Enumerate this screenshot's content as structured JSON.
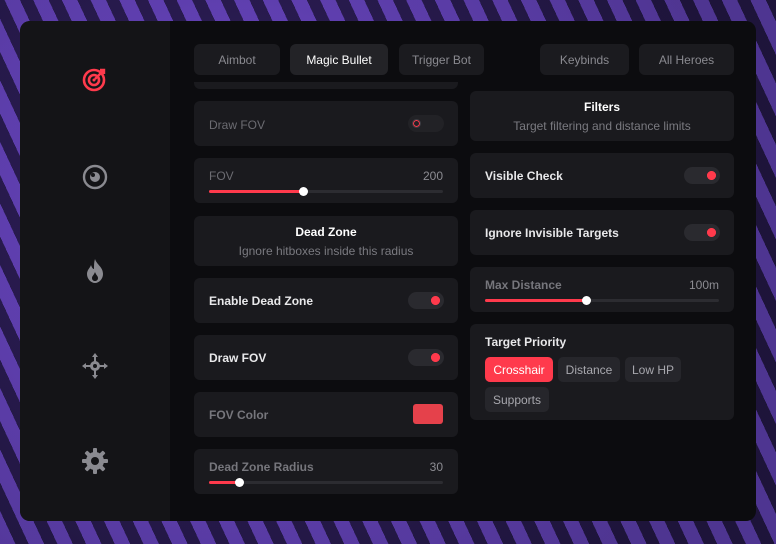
{
  "sidebar": {
    "items": [
      {
        "icon": "target-icon",
        "active": true
      },
      {
        "icon": "eye-icon",
        "active": false
      },
      {
        "icon": "flame-icon",
        "active": false
      },
      {
        "icon": "crosshair-move-icon",
        "active": false
      },
      {
        "icon": "gear-icon",
        "active": false
      }
    ]
  },
  "tabs": {
    "aimbot": "Aimbot",
    "magic_bullet": "Magic Bullet",
    "trigger_bot": "Trigger Bot",
    "keybinds": "Keybinds",
    "all_heroes": "All Heroes"
  },
  "left": {
    "draw_fov_disabled": {
      "label": "Draw FOV",
      "enabled": false
    },
    "fov": {
      "label": "FOV",
      "value": "200",
      "fraction": 0.4
    },
    "dead_zone_header": {
      "title": "Dead Zone",
      "subtitle": "Ignore hitboxes inside this radius"
    },
    "enable_dead_zone": {
      "label": "Enable Dead Zone",
      "enabled": true
    },
    "draw_fov": {
      "label": "Draw FOV",
      "enabled": true
    },
    "fov_color": {
      "label": "FOV Color",
      "color": "#e5414b"
    },
    "dead_zone_radius": {
      "label": "Dead Zone Radius",
      "value": "30",
      "fraction": 0.13
    }
  },
  "right": {
    "filters_header": {
      "title": "Filters",
      "subtitle": "Target filtering and distance limits"
    },
    "visible_check": {
      "label": "Visible Check",
      "enabled": true
    },
    "ignore_invisible": {
      "label": "Ignore Invisible Targets",
      "enabled": true
    },
    "max_distance": {
      "label": "Max Distance",
      "value": "100m",
      "fraction": 0.43
    },
    "target_priority": {
      "label": "Target Priority",
      "options": [
        "Crosshair",
        "Distance",
        "Low HP",
        "Supports"
      ],
      "selected": "Crosshair"
    }
  },
  "colors": {
    "accent": "#ff3a4c",
    "panel": "#0c0c0f",
    "card": "#1a1a1e"
  }
}
